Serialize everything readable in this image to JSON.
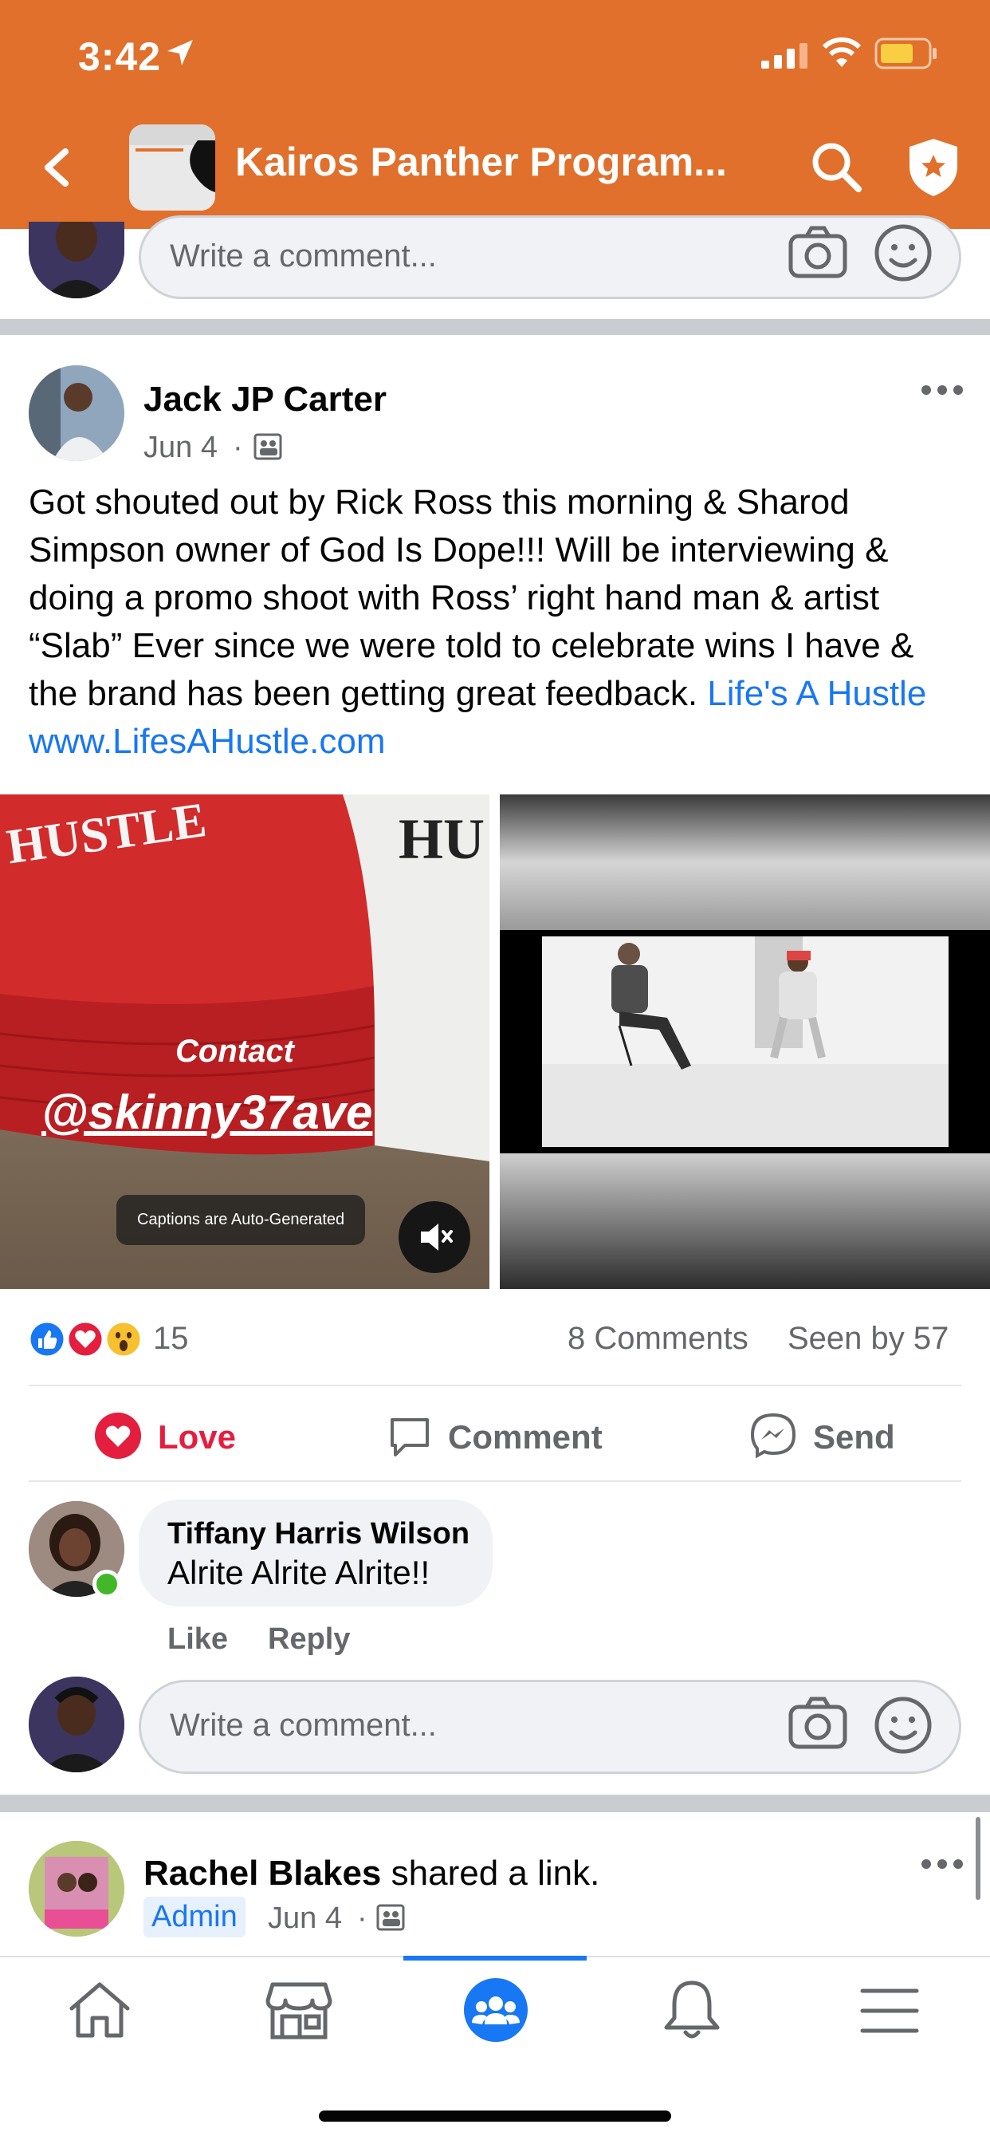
{
  "status_bar": {
    "time": "3:42"
  },
  "header": {
    "title": "Kairos Panther Program..."
  },
  "top_comment_box": {
    "placeholder": "Write a comment..."
  },
  "post": {
    "author": "Jack JP Carter",
    "date": "Jun 4",
    "body_text": "Got shouted out by Rick Ross this morning & Sharod Simpson owner of God Is Dope!!! Will be interviewing & doing a promo shoot with Ross’ right hand man & artist “Slab” Ever since we were told to celebrate wins I have & the brand has been getting great feedback. ",
    "link_text": "Life's A Hustle",
    "url_text": "www.LifesAHustle.com",
    "video_overlay": {
      "contact": "Contact",
      "handle": "@skinny37ave",
      "captions_badge": "Captions are Auto-Generated"
    },
    "reaction_count": "15",
    "comments_count": "8 Comments",
    "seen_by": "Seen by 57",
    "actions": {
      "love": "Love",
      "comment": "Comment",
      "send": "Send"
    },
    "comment": {
      "author": "Tiffany Harris Wilson",
      "text": "Alrite Alrite Alrite!!",
      "like": "Like",
      "reply": "Reply"
    },
    "comment_box_placeholder": "Write a comment..."
  },
  "next_post": {
    "author": "Rachel Blakes",
    "action": "shared a link.",
    "badge": "Admin",
    "date": "Jun 4"
  },
  "colors": {
    "header_bg": "#e0702c",
    "link": "#1877f2",
    "love": "#e41e3f",
    "active_tab": "#1877f2"
  },
  "tabs": [
    "home-icon",
    "marketplace-icon",
    "groups-icon",
    "notifications-icon",
    "menu-icon"
  ],
  "active_tab": "groups-icon"
}
